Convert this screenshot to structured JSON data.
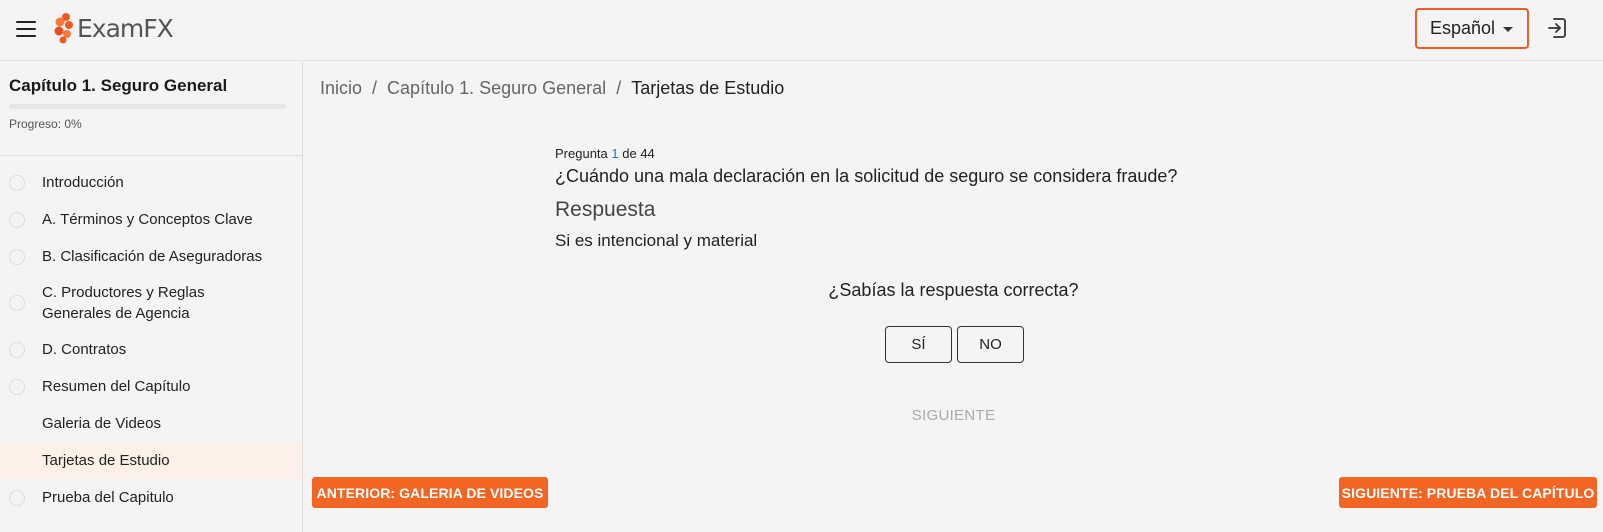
{
  "header": {
    "menu_icon": "hamburger-menu-icon",
    "logo_text": "ExamFX",
    "language": "Español",
    "logout_icon": "logout-icon",
    "accent_color": "#f15a22"
  },
  "sidebar": {
    "title": "Capítulo 1. Seguro General",
    "progress_label": "Progreso: 0%",
    "progress_fraction": 0,
    "items": [
      {
        "label": "Introducción",
        "has_dot": true,
        "active": false
      },
      {
        "label": "A. Términos y Conceptos Clave",
        "has_dot": true,
        "active": false
      },
      {
        "label": "B. Clasificación de Aseguradoras",
        "has_dot": true,
        "active": false
      },
      {
        "label": "C. Productores y Reglas Generales de Agencia",
        "has_dot": true,
        "active": false
      },
      {
        "label": "D. Contratos",
        "has_dot": true,
        "active": false
      },
      {
        "label": "Resumen del Capítulo",
        "has_dot": true,
        "active": false
      },
      {
        "label": "Galeria de Videos",
        "has_dot": false,
        "active": false
      },
      {
        "label": "Tarjetas de Estudio",
        "has_dot": false,
        "active": true
      },
      {
        "label": "Prueba del Capitulo",
        "has_dot": true,
        "active": false
      }
    ]
  },
  "breadcrumb": {
    "items": [
      "Inicio",
      "Capítulo 1. Seguro General"
    ],
    "separator": "/",
    "current": "Tarjetas de Estudio"
  },
  "flashcard": {
    "count_prefix": "Pregunta",
    "count_current": "1",
    "count_suffix": "de 44",
    "question": "¿Cuándo una mala declaración en la solicitud de seguro se considera fraude?",
    "answer_label": "Respuesta",
    "answer": "Si es intencional y material",
    "knew_prompt": "¿Sabías la respuesta correcta?",
    "yes_label": "SÍ",
    "no_label": "NO",
    "next_label": "SIGUIENTE"
  },
  "navigation": {
    "prev_label": "ANTERIOR: GALERIA DE VIDEOS",
    "next_label": "SIGUIENTE: PRUEBA DEL CAPÍTULO"
  }
}
